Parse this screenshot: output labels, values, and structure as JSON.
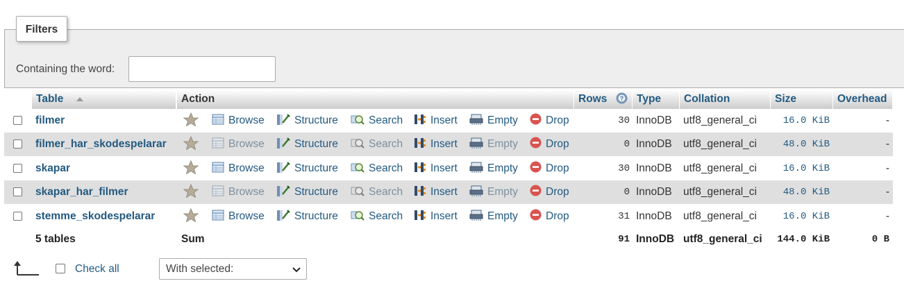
{
  "filters": {
    "legend": "Filters",
    "label": "Containing the word:",
    "input_value": "",
    "input_placeholder": ""
  },
  "table": {
    "headers": {
      "table": "Table",
      "action": "Action",
      "rows": "Rows",
      "type": "Type",
      "collation": "Collation",
      "size": "Size",
      "overhead": "Overhead"
    },
    "actions": {
      "browse": "Browse",
      "structure": "Structure",
      "search": "Search",
      "insert": "Insert",
      "empty": "Empty",
      "drop": "Drop"
    },
    "rows": [
      {
        "name": "filmer",
        "rows": "30",
        "type": "InnoDB",
        "collation": "utf8_general_ci",
        "size": "16.0 KiB",
        "overhead": "-",
        "empty_table": false
      },
      {
        "name": "filmer_har_skodespelarar",
        "rows": "0",
        "type": "InnoDB",
        "collation": "utf8_general_ci",
        "size": "48.0 KiB",
        "overhead": "-",
        "empty_table": true
      },
      {
        "name": "skapar",
        "rows": "30",
        "type": "InnoDB",
        "collation": "utf8_general_ci",
        "size": "16.0 KiB",
        "overhead": "-",
        "empty_table": false
      },
      {
        "name": "skapar_har_filmer",
        "rows": "0",
        "type": "InnoDB",
        "collation": "utf8_general_ci",
        "size": "48.0 KiB",
        "overhead": "-",
        "empty_table": true
      },
      {
        "name": "stemme_skodespelarar",
        "rows": "31",
        "type": "InnoDB",
        "collation": "utf8_general_ci",
        "size": "16.0 KiB",
        "overhead": "-",
        "empty_table": false
      }
    ],
    "summary": {
      "tables": "5 tables",
      "label": "Sum",
      "rows": "91",
      "type": "InnoDB",
      "collation": "utf8_general_ci",
      "size": "144.0 KiB",
      "overhead": "0 B"
    }
  },
  "footer": {
    "check_all": "Check all",
    "with_selected": "With selected:"
  },
  "colors": {
    "link": "#235a81",
    "row_even": "#dfdfdf",
    "drop_icon": "#d9534f"
  }
}
